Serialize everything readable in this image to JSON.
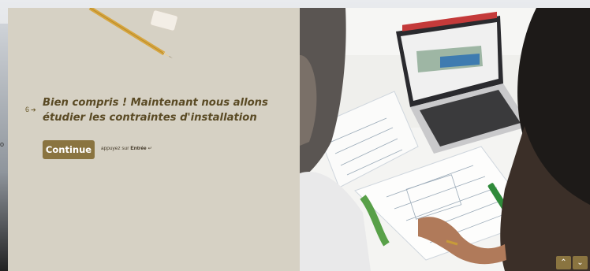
{
  "question": {
    "number": "6",
    "arrow_icon": "arrow-right-icon",
    "text": "Bien compris ! Maintenant nous allons étudier les contraintes d'installation"
  },
  "actions": {
    "continue_label": "Continue",
    "hint_prefix": "appuyez sur",
    "hint_key": "Entrée",
    "hint_icon": "enter-key-icon"
  },
  "background_peek_text": "o",
  "navigation": {
    "up_icon": "chevron-up-icon",
    "down_icon": "chevron-down-icon"
  },
  "colors": {
    "panel_bg": "#d6d1c4",
    "accent": "#8a7440",
    "text": "#5a4a24"
  }
}
